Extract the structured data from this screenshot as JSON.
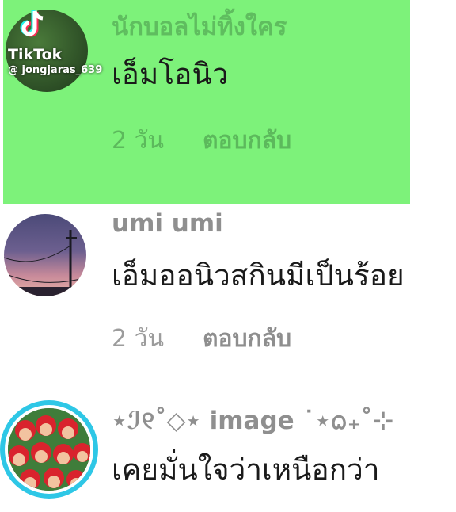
{
  "watermark": {
    "brand": "TikTok",
    "handle": "@ jongjaras_639"
  },
  "comments": [
    {
      "username": "นักบอลไม่ทิ้งใคร",
      "text": "เอ็มโอนิว",
      "time": "2 วัน",
      "reply": "ตอบกลับ"
    },
    {
      "username": "umi umi",
      "text": "เอ็มออนิวสกินมีเป็นร้อย",
      "time": "2 วัน",
      "reply": "ตอบกลับ"
    },
    {
      "username": "⋆ℐ୧˚◇⋆ image ˙⋆ᨵ₊˚⊹",
      "text": "เคยมั่นใจว่าเหนือกว่า"
    }
  ],
  "colors": {
    "highlight": "#7df27a",
    "story_ring": "#2ec7e6"
  }
}
